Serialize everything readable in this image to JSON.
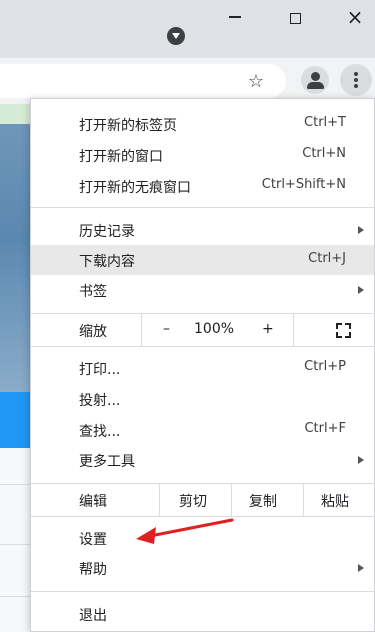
{
  "window": {
    "minimize_glyph": "–",
    "maximize_glyph": "□",
    "close_glyph": "×"
  },
  "toolbar": {
    "bookmark_icon": "star-icon",
    "profile_icon": "person-icon",
    "menu_icon": "more-vert-icon"
  },
  "menu": {
    "new_tab": {
      "label": "打开新的标签页",
      "shortcut": "Ctrl+T"
    },
    "new_window": {
      "label": "打开新的窗口",
      "shortcut": "Ctrl+N"
    },
    "incognito": {
      "label": "打开新的无痕窗口",
      "shortcut": "Ctrl+Shift+N"
    },
    "history": {
      "label": "历史记录"
    },
    "downloads": {
      "label": "下载内容",
      "shortcut": "Ctrl+J"
    },
    "bookmarks": {
      "label": "书签"
    },
    "zoom": {
      "label": "缩放",
      "minus": "–",
      "value": "100%",
      "plus": "+"
    },
    "print": {
      "label": "打印...",
      "shortcut": "Ctrl+P"
    },
    "cast": {
      "label": "投射..."
    },
    "find": {
      "label": "查找...",
      "shortcut": "Ctrl+F"
    },
    "more_tools": {
      "label": "更多工具"
    },
    "edit": {
      "label": "编辑",
      "cut": "剪切",
      "copy": "复制",
      "paste": "粘贴"
    },
    "settings": {
      "label": "设置"
    },
    "help": {
      "label": "帮助"
    },
    "exit": {
      "label": "退出"
    }
  },
  "colors": {
    "annotation_arrow": "#e02020",
    "highlight_row": "#e8e8e8"
  }
}
